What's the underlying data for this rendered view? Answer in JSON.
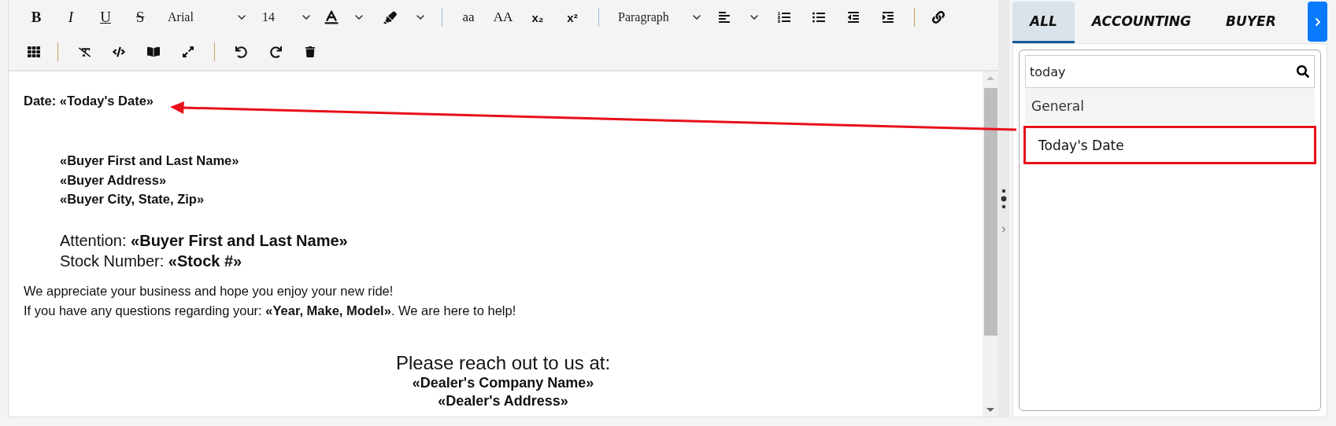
{
  "toolbar": {
    "format_buttons": [
      "B",
      "I",
      "U",
      "S"
    ],
    "font": {
      "value": "Arial"
    },
    "size": {
      "value": "14"
    },
    "case_buttons": [
      "aa",
      "AA"
    ],
    "script_buttons": [
      "x₂",
      "x²"
    ],
    "block_format": {
      "value": "Paragraph"
    }
  },
  "document": {
    "blocks": [
      {
        "kind": "date",
        "text": "Date: «Today's Date»"
      },
      {
        "kind": "address",
        "lines": [
          "«Buyer First and Last Name»",
          "«Buyer Address»",
          "«Buyer City, State, Zip»"
        ]
      },
      {
        "kind": "attention",
        "lines": [
          "Attention: **«Buyer First and Last Name»**",
          "Stock Number: **«Stock #»**"
        ]
      },
      {
        "kind": "body",
        "lines": [
          "We appreciate your business and hope you enjoy your new ride!",
          "If you have any questions regarding your: **«Year, Make, Model»**. We are here to help!"
        ]
      },
      {
        "kind": "contact",
        "title": "Please reach out to us at:",
        "lines": [
          "«Dealer's Company Name»",
          "«Dealer's Address»"
        ]
      }
    ]
  },
  "panel": {
    "tabs": [
      {
        "label": "ALL",
        "selected": true
      },
      {
        "label": "ACCOUNTING",
        "selected": false
      },
      {
        "label": "BUYER",
        "selected": false
      }
    ],
    "search": {
      "value": "today"
    },
    "groups": [
      {
        "title": "General",
        "items": [
          {
            "label": "Today's Date",
            "highlighted": true
          }
        ]
      }
    ]
  }
}
